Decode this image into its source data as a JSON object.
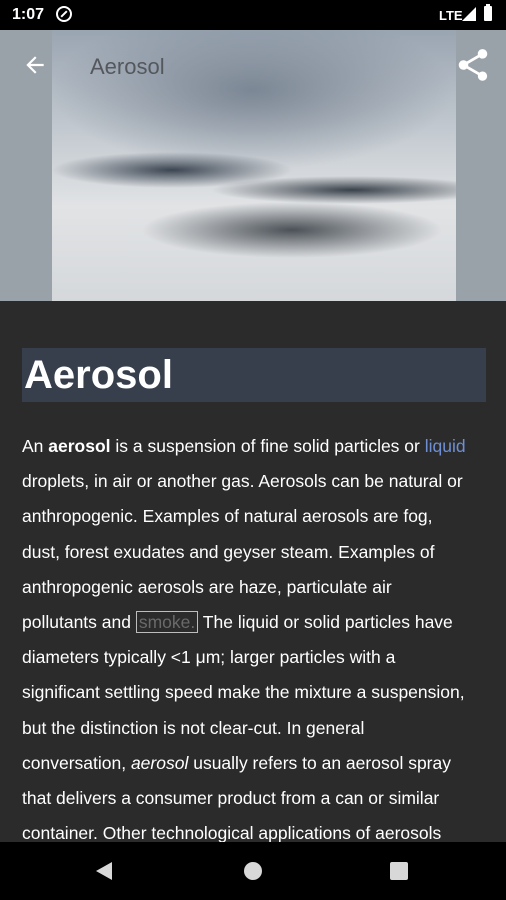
{
  "status_bar": {
    "time": "1:07",
    "network": "LTE"
  },
  "toolbar": {
    "title": "Aerosol"
  },
  "article": {
    "heading": "Aerosol",
    "paragraph": {
      "l1_a": "An ",
      "l1_b": "aerosol",
      "l1_c": " is a suspension of fine solid particles or ",
      "l1_link": "liquid",
      "l2": "droplets, in air or another gas. Aerosols can be natural or",
      "l3": "anthropogenic. Examples of natural aerosols are fog,",
      "l4": "dust, forest exudates and geyser steam. Examples of",
      "l5": "anthropogenic aerosols are haze, particulate air",
      "l6_a": "pollutants and ",
      "l6_boxed": "smoke.",
      "l6_c": " The liquid or solid particles have",
      "l7": "diameters typically <1 μm; larger particles with a",
      "l8": "significant settling speed make the mixture a suspension,",
      "l9": "but the distinction is not clear-cut. In general",
      "l10_a": "conversation, ",
      "l10_b": "aerosol",
      "l10_c": " usually refers to an aerosol spray",
      "l11": "that delivers a consumer product from a can or similar",
      "l12": "container. Other technological applications of aerosols"
    }
  },
  "icons": {
    "back": "arrow-back-icon",
    "share": "share-icon",
    "nav_back": "triangle-back-icon",
    "nav_home": "circle-home-icon",
    "nav_recents": "square-recents-icon"
  },
  "colors": {
    "background": "#2b2b2b",
    "heading_bg": "#373e4c",
    "link": "#6f8fd2"
  }
}
